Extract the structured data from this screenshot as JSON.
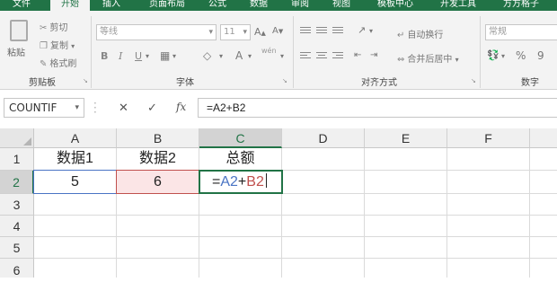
{
  "tabs": [
    "文件",
    "开始",
    "插入",
    "页面布局",
    "公式",
    "数据",
    "审阅",
    "视图",
    "模板中心",
    "开发工具",
    "方方格子"
  ],
  "active_tab": "开始",
  "clipboard": {
    "paste": "粘贴",
    "cut": "剪切",
    "copy": "复制",
    "format_painter": "格式刷",
    "group_label": "剪贴板"
  },
  "font": {
    "name": "等线",
    "size": "11",
    "bold": "B",
    "italic": "I",
    "underline": "U",
    "phonetic": "wén",
    "group_label": "字体"
  },
  "alignment": {
    "wrap_text": "自动换行",
    "merge_center": "合并后居中",
    "group_label": "对齐方式"
  },
  "number": {
    "format": "常规",
    "percent": "%",
    "comma": "9",
    "group_label": "数字"
  },
  "formula_bar": {
    "name_box": "COUNTIF",
    "fx": "fx",
    "formula": "=A2+B2"
  },
  "columns": [
    "A",
    "B",
    "C",
    "D",
    "E",
    "F"
  ],
  "rows": [
    "1",
    "2",
    "3",
    "4",
    "5",
    "6"
  ],
  "cells": {
    "A1": "数据1",
    "B1": "数据2",
    "C1": "总额",
    "A2": "5",
    "B2": "6"
  },
  "editing": {
    "eq": "=",
    "ref_a": "A2",
    "op": "+",
    "ref_b": "B2"
  },
  "colors": {
    "accent": "#217346",
    "ref_a": "#4a74c4",
    "ref_b": "#c0504d"
  }
}
